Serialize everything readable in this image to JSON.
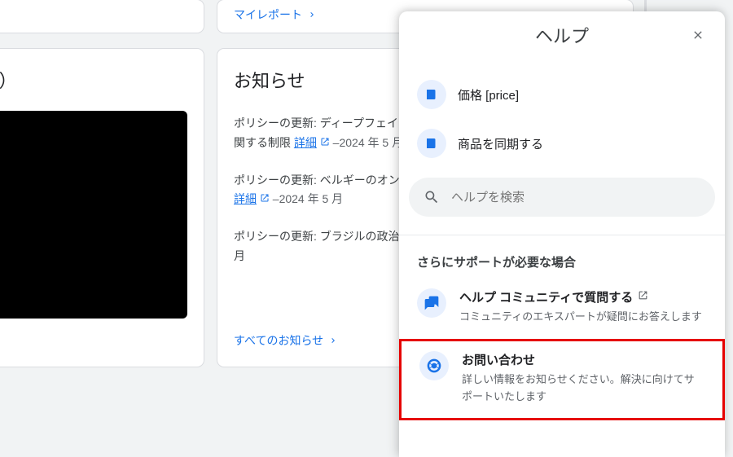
{
  "bg": {
    "my_report_link": "マイレポート",
    "main_left_title": "スティング）",
    "announce_title": "お知らせ",
    "announcements": [
      {
        "text": "ポリシーの更新: ディープフェイ",
        "link": "関する制限",
        "detail": "詳細",
        "date": "2024 年 5 月"
      },
      {
        "text": "ポリシーの更新: ベルギーのオン",
        "detail": "詳細",
        "date": "2024 年 5 月"
      },
      {
        "text": "ポリシーの更新: ブラジルの政治",
        "suffix": "月"
      }
    ],
    "all_announcements": "すべてのお知らせ"
  },
  "help": {
    "title": "ヘルプ",
    "articles": [
      {
        "label": "価格 [price]"
      },
      {
        "label": "商品を同期する"
      }
    ],
    "search_placeholder": "ヘルプを検索",
    "more_support_label": "さらにサポートが必要な場合",
    "community": {
      "title": "ヘルプ コミュニティで質問する",
      "desc": "コミュニティのエキスパートが疑問にお答えします"
    },
    "contact": {
      "title": "お問い合わせ",
      "desc": "詳しい情報をお知らせください。解決に向けてサポートいたします"
    }
  }
}
